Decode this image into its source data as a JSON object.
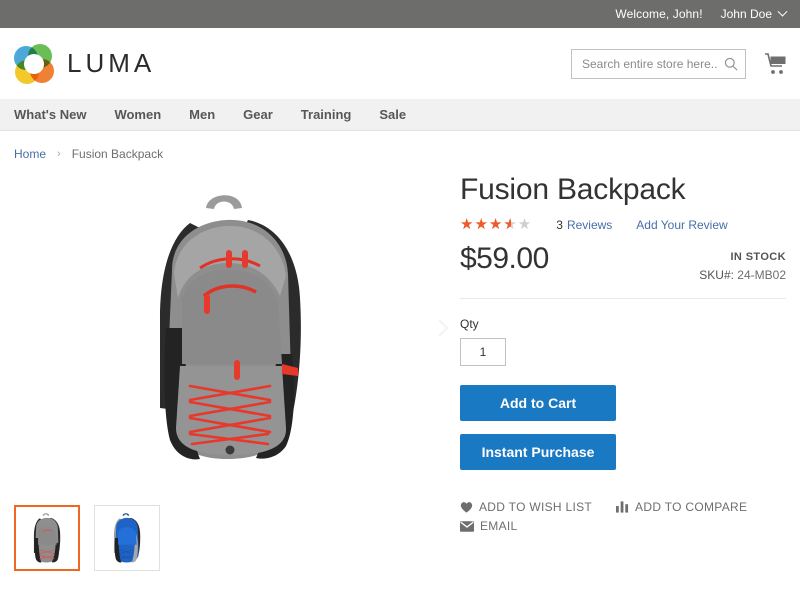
{
  "top_panel": {
    "welcome": "Welcome, John!",
    "account_name": "John Doe",
    "chevron_icon": "chevron-down-icon"
  },
  "header": {
    "logo_text": "LUMA",
    "logo_icon": "luma-logo-icon",
    "search": {
      "placeholder": "Search entire store here...",
      "value": "",
      "icon": "search-icon"
    },
    "cart_icon": "shopping-cart-icon"
  },
  "nav": {
    "items": [
      {
        "label": "What's New"
      },
      {
        "label": "Women"
      },
      {
        "label": "Men"
      },
      {
        "label": "Gear"
      },
      {
        "label": "Training"
      },
      {
        "label": "Sale"
      }
    ]
  },
  "breadcrumb": {
    "home": "Home",
    "separator": "›",
    "current": "Fusion Backpack"
  },
  "gallery": {
    "next_arrow_icon": "chevron-right-icon",
    "main_image_alt": "Fusion Backpack gray",
    "thumbnails": [
      {
        "name": "thumbnail-gray-backpack",
        "selected": true
      },
      {
        "name": "thumbnail-blue-backpack",
        "selected": false
      }
    ]
  },
  "product": {
    "title": "Fusion Backpack",
    "rating_percent": 70,
    "reviews_count": "3",
    "reviews_label": "Reviews",
    "add_review_label": "Add Your Review",
    "price": "$59.00",
    "stock_status": "IN STOCK",
    "sku_label": "SKU#:",
    "sku_value": "24-MB02",
    "qty_label": "Qty",
    "qty_value": "1",
    "add_to_cart_label": "Add to Cart",
    "instant_purchase_label": "Instant Purchase",
    "actions": [
      {
        "label": "ADD TO WISH LIST",
        "icon": "heart-icon"
      },
      {
        "label": "ADD TO COMPARE",
        "icon": "bar-chart-icon"
      },
      {
        "label": "EMAIL",
        "icon": "envelope-icon"
      }
    ]
  },
  "colors": {
    "top_panel_bg": "#6d6e6b",
    "nav_bg": "#f1f1f1",
    "primary_button": "#1979c3",
    "link": "#476fa8",
    "star_active": "#ef5a26",
    "thumb_active_border": "#ef6725"
  }
}
